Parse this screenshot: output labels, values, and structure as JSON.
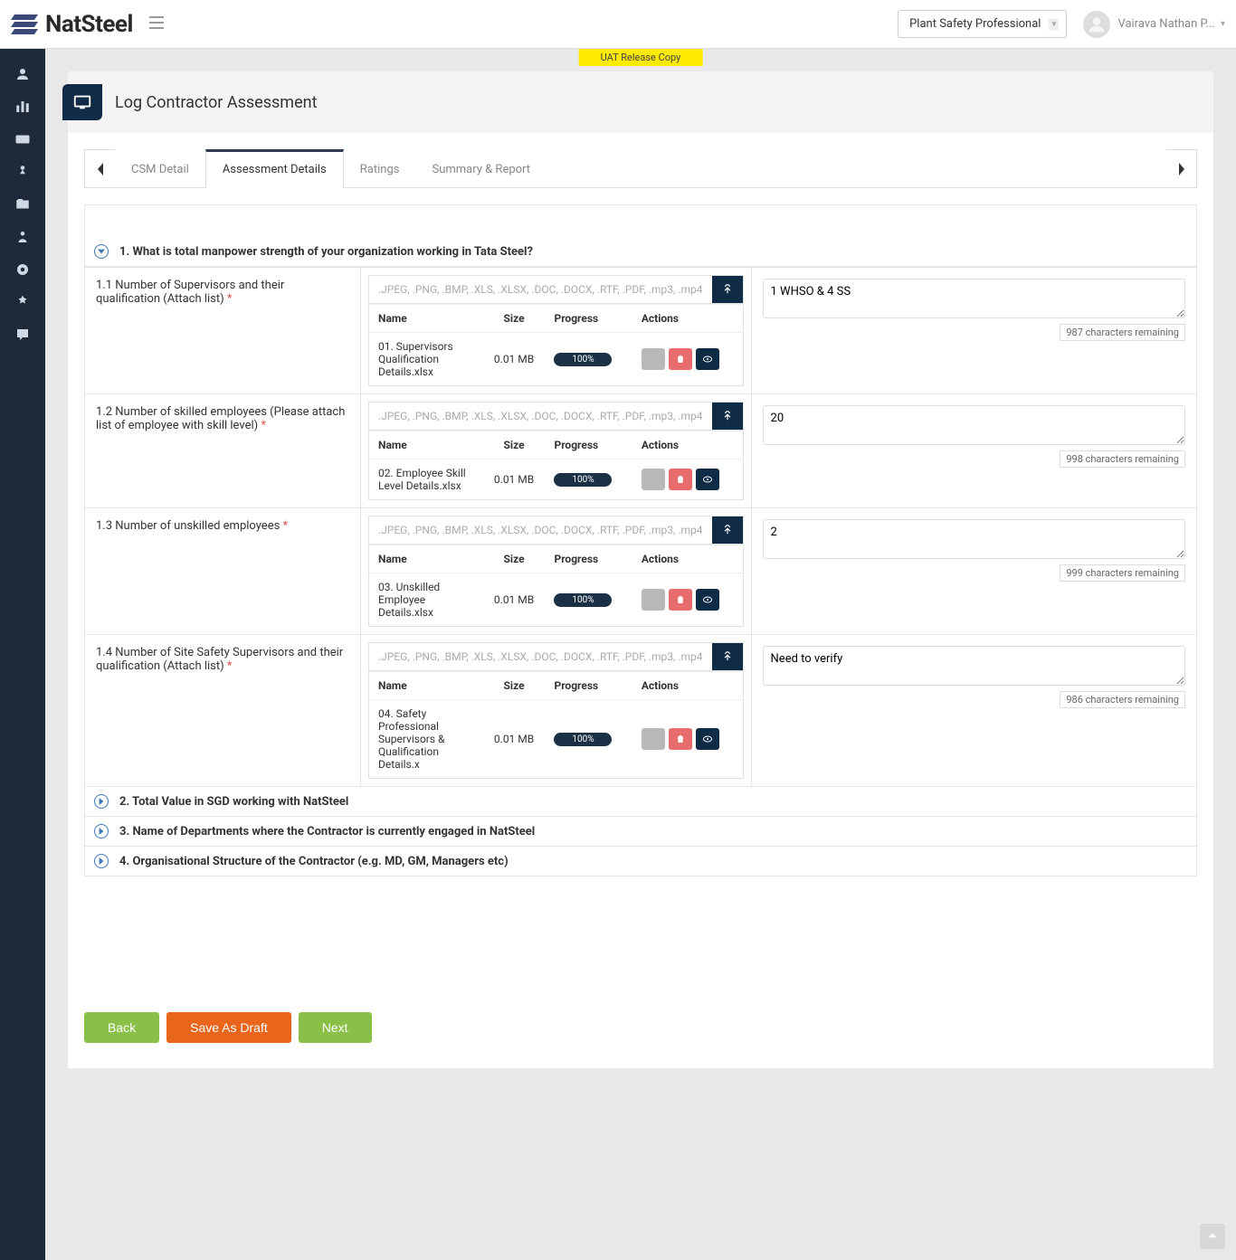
{
  "brand": "NatSteel",
  "uat_banner": "UAT Release Copy",
  "role": "Plant Safety Professional",
  "user_name": "Vairava Nathan P...",
  "page_title": "Log Contractor Assessment",
  "tabs": {
    "csm": "CSM Detail",
    "assessment": "Assessment Details",
    "ratings": "Ratings",
    "summary": "Summary & Report"
  },
  "upload_hint": ".JPEG, .PNG, .BMP, .XLS, .XLSX, .DOC, .DOCX, .RTF, .PDF, .mp3, .mp4",
  "file_headers": {
    "name": "Name",
    "size": "Size",
    "progress": "Progress",
    "actions": "Actions"
  },
  "section1": {
    "title": "1. What is total manpower strength of your organization working in Tata Steel?",
    "q1": {
      "label": "1.1 Number of Supervisors and their qualification (Attach list)",
      "file_name": "01. Supervisors Qualification Details.xlsx",
      "file_size": "0.01 MB",
      "file_progress": "100%",
      "answer": "1 WHSO & 4 SS",
      "remaining": "987 characters remaining"
    },
    "q2": {
      "label": "1.2 Number of skilled employees (Please attach list of employee with skill level)",
      "file_name": "02. Employee Skill Level Details.xlsx",
      "file_size": "0.01 MB",
      "file_progress": "100%",
      "answer": "20",
      "remaining": "998 characters remaining"
    },
    "q3": {
      "label": "1.3 Number of unskilled employees",
      "file_name": "03. Unskilled Employee Details.xlsx",
      "file_size": "0.01 MB",
      "file_progress": "100%",
      "answer": "2",
      "remaining": "999 characters remaining"
    },
    "q4": {
      "label": "1.4 Number of Site Safety Supervisors and their qualification (Attach list)",
      "file_name": "04. Safety Professional Supervisors & Qualification Details.x",
      "file_size": "0.01 MB",
      "file_progress": "100%",
      "answer": "Need to verify",
      "remaining": "986 characters remaining"
    }
  },
  "section2": "2. Total Value in SGD working with NatSteel",
  "section3": "3. Name of Departments where the Contractor is currently engaged in NatSteel",
  "section4": "4. Organisational Structure of the Contractor (e.g. MD, GM, Managers etc)",
  "buttons": {
    "back": "Back",
    "save_draft": "Save As Draft",
    "next": "Next"
  }
}
